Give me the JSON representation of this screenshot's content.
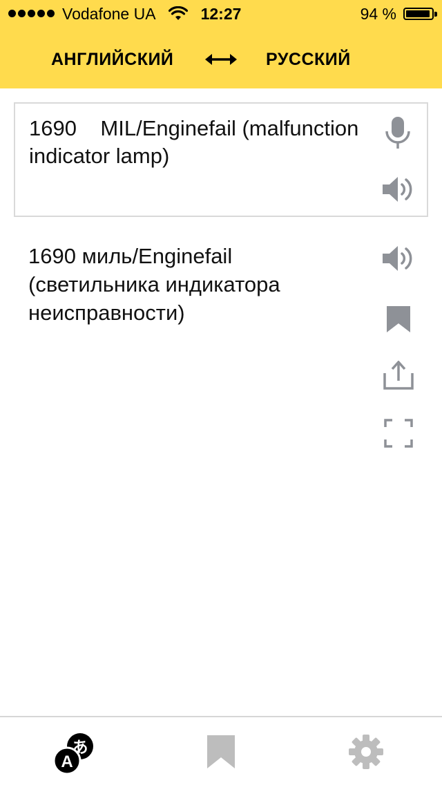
{
  "status_bar": {
    "carrier": "Vodafone UA",
    "time": "12:27",
    "battery": "94 %"
  },
  "languages": {
    "source": "АНГЛИЙСКИЙ",
    "target": "РУССКИЙ"
  },
  "input": {
    "text": "1690    MIL/Enginefail (malfunction indicator lamp)"
  },
  "output": {
    "text": "1690 миль/Enginefail (светильника индикатора неисправности)"
  },
  "tabbar": {
    "active": "translate"
  },
  "colors": {
    "header": "#ffdb4d",
    "icon_gray": "#8e9197",
    "tab_gray": "#bdbdbd"
  },
  "icons": {
    "input": [
      "microphone-icon",
      "speaker-icon"
    ],
    "output": [
      "speaker-icon",
      "bookmark-icon",
      "share-icon",
      "fullscreen-icon"
    ],
    "tabs": [
      "translate-icon",
      "bookmark-icon",
      "gear-icon"
    ]
  }
}
